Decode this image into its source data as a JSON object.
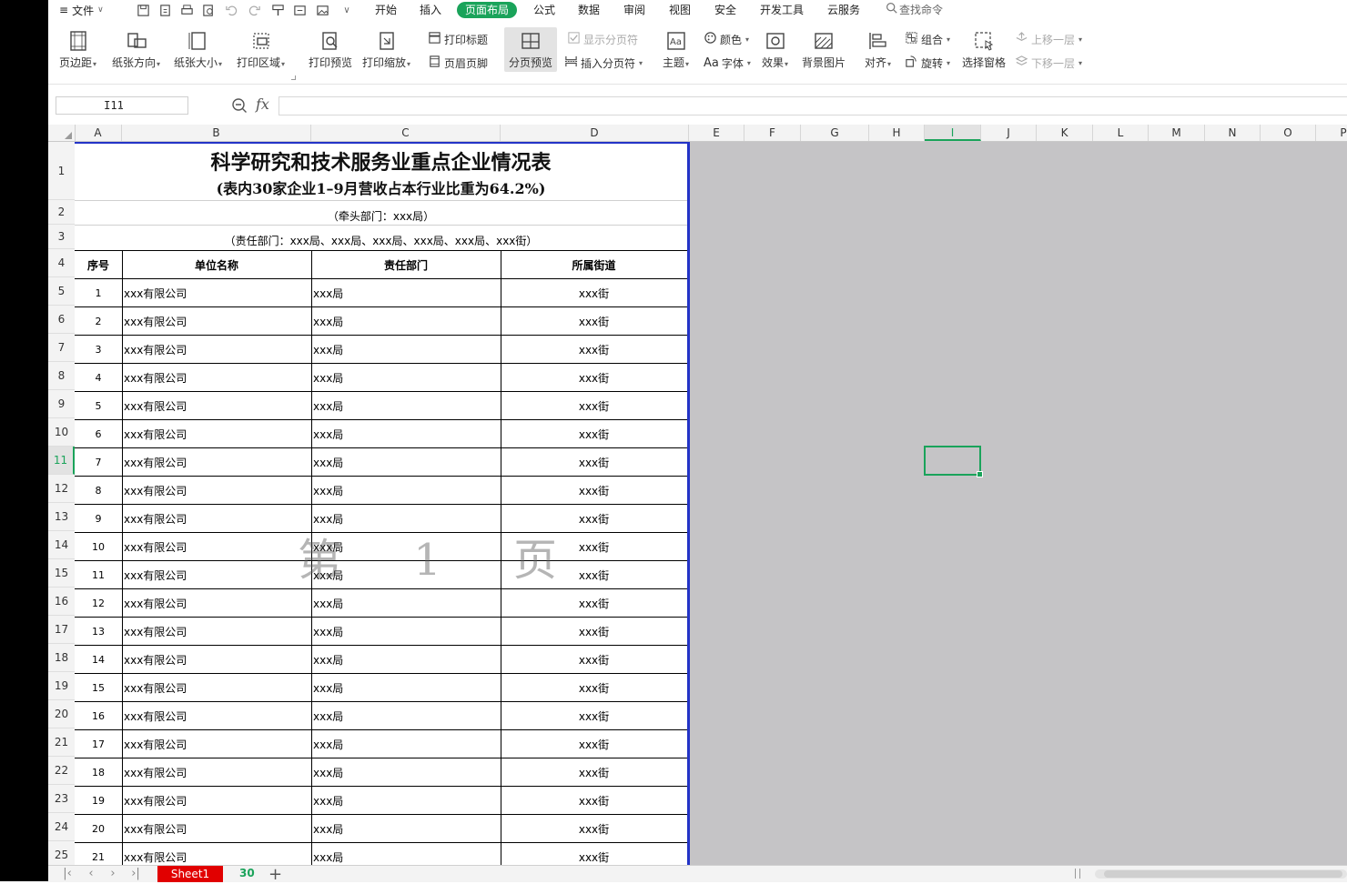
{
  "menu": {
    "file_label": "文件",
    "tabs": [
      "开始",
      "插入",
      "页面布局",
      "公式",
      "数据",
      "审阅",
      "视图",
      "安全",
      "开发工具",
      "云服务"
    ],
    "active_tab_index": 2,
    "search_placeholder": "查找命令"
  },
  "ribbon": {
    "margins": "页边距",
    "orientation": "纸张方向",
    "size": "纸张大小",
    "print_area": "打印区域",
    "print_preview": "打印预览",
    "print_scale": "打印缩放",
    "print_titles": "打印标题",
    "header_footer": "页眉页脚",
    "page_break_preview": "分页预览",
    "show_page_breaks": "显示分页符",
    "insert_page_break": "插入分页符",
    "theme": "主题",
    "colors": "颜色",
    "fonts": "字体",
    "effects": "效果",
    "background": "背景图片",
    "align": "对齐",
    "group": "组合",
    "rotate": "旋转",
    "selection_pane": "选择窗格",
    "bring_forward": "上移一层",
    "send_backward": "下移一层"
  },
  "formula_bar": {
    "name_box": "I11",
    "fx": "fx",
    "formula": ""
  },
  "columns": {
    "labels": [
      "A",
      "B",
      "C",
      "D",
      "E",
      "F",
      "G",
      "H",
      "I",
      "J",
      "K",
      "L",
      "M",
      "N",
      "O",
      "P"
    ],
    "selected": "I"
  },
  "rows": {
    "labels": [
      "1",
      "2",
      "3",
      "4",
      "5",
      "6",
      "7",
      "8",
      "9",
      "10",
      "11",
      "12",
      "13",
      "14",
      "15",
      "16",
      "17",
      "18",
      "19",
      "20",
      "21",
      "22",
      "23",
      "24",
      "25"
    ],
    "selected": "11"
  },
  "sheet": {
    "title": "科学研究和技术服务业重点企业情况表",
    "subtitle": "(表内30家企业1–9月营收占本行业比重为64.2%)",
    "lead_dept": "（牵头部门：xxx局）",
    "resp_depts": "（责任部门：xxx局、xxx局、xxx局、xxx局、xxx局、xxx街）",
    "headers": [
      "序号",
      "单位名称",
      "责任部门",
      "所属街道"
    ],
    "rows": [
      {
        "no": "1",
        "name": "xxx有限公司",
        "dept": "xxx局",
        "street": "xxx街"
      },
      {
        "no": "2",
        "name": "xxx有限公司",
        "dept": "xxx局",
        "street": "xxx街"
      },
      {
        "no": "3",
        "name": "xxx有限公司",
        "dept": "xxx局",
        "street": "xxx街"
      },
      {
        "no": "4",
        "name": "xxx有限公司",
        "dept": "xxx局",
        "street": "xxx街"
      },
      {
        "no": "5",
        "name": "xxx有限公司",
        "dept": "xxx局",
        "street": "xxx街"
      },
      {
        "no": "6",
        "name": "xxx有限公司",
        "dept": "xxx局",
        "street": "xxx街"
      },
      {
        "no": "7",
        "name": "xxx有限公司",
        "dept": "xxx局",
        "street": "xxx街"
      },
      {
        "no": "8",
        "name": "xxx有限公司",
        "dept": "xxx局",
        "street": "xxx街"
      },
      {
        "no": "9",
        "name": "xxx有限公司",
        "dept": "xxx局",
        "street": "xxx街"
      },
      {
        "no": "10",
        "name": "xxx有限公司",
        "dept": "xxx局",
        "street": "xxx街"
      },
      {
        "no": "11",
        "name": "xxx有限公司",
        "dept": "xxx局",
        "street": "xxx街"
      },
      {
        "no": "12",
        "name": "xxx有限公司",
        "dept": "xxx局",
        "street": "xxx街"
      },
      {
        "no": "13",
        "name": "xxx有限公司",
        "dept": "xxx局",
        "street": "xxx街"
      },
      {
        "no": "14",
        "name": "xxx有限公司",
        "dept": "xxx局",
        "street": "xxx街"
      },
      {
        "no": "15",
        "name": "xxx有限公司",
        "dept": "xxx局",
        "street": "xxx街"
      },
      {
        "no": "16",
        "name": "xxx有限公司",
        "dept": "xxx局",
        "street": "xxx街"
      },
      {
        "no": "17",
        "name": "xxx有限公司",
        "dept": "xxx局",
        "street": "xxx街"
      },
      {
        "no": "18",
        "name": "xxx有限公司",
        "dept": "xxx局",
        "street": "xxx街"
      },
      {
        "no": "19",
        "name": "xxx有限公司",
        "dept": "xxx局",
        "street": "xxx街"
      },
      {
        "no": "20",
        "name": "xxx有限公司",
        "dept": "xxx局",
        "street": "xxx街"
      },
      {
        "no": "21",
        "name": "xxx有限公司",
        "dept": "xxx局",
        "street": "xxx街"
      }
    ],
    "watermark": "第 1 页"
  },
  "bottom": {
    "sheet_name": "Sheet1",
    "count": "30",
    "add": "+"
  },
  "colors": {
    "accent": "#1aa35a",
    "page_border": "#2333c7",
    "sheet_tab": "#e10000",
    "outside_area": "#c5c4c6"
  }
}
